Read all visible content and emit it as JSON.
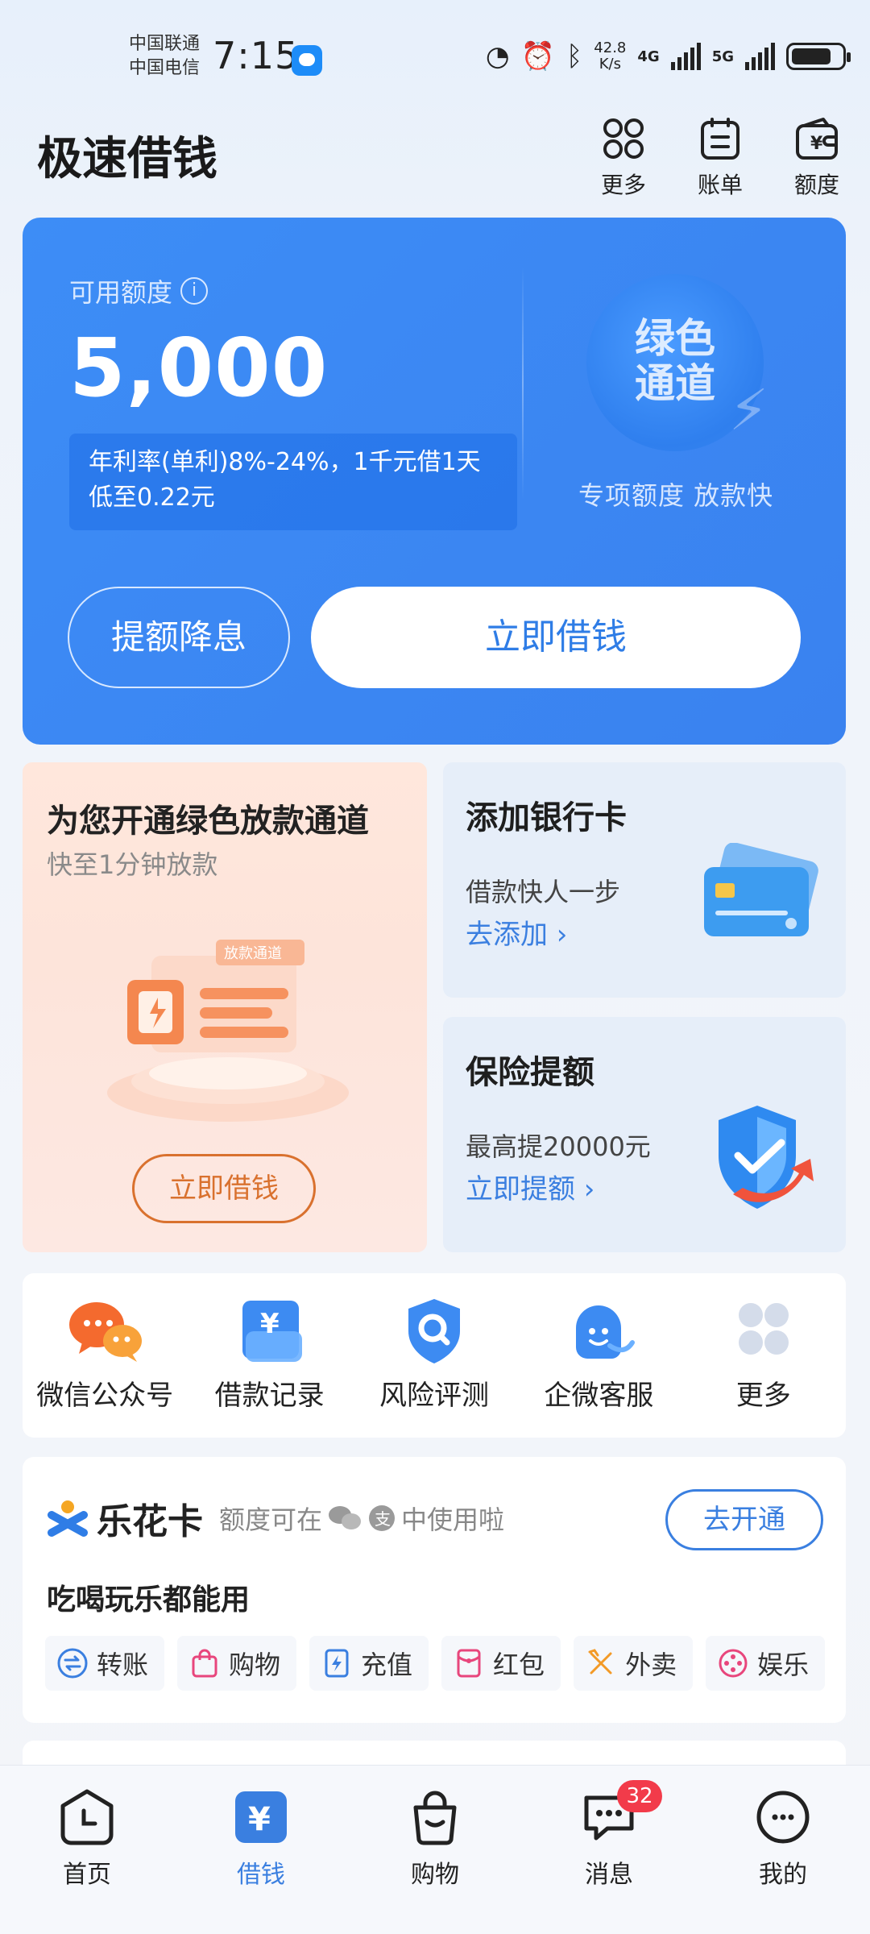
{
  "status_bar": {
    "carrier1": "中国联通",
    "carrier2": "中国电信",
    "time": "7:15",
    "net_speed_value": "42.8",
    "net_speed_unit": "K/s",
    "net1": "4G",
    "net2": "5G"
  },
  "header": {
    "title": "极速借钱",
    "actions": [
      {
        "label": "更多",
        "icon": "grid-icon"
      },
      {
        "label": "账单",
        "icon": "bill-icon"
      },
      {
        "label": "额度",
        "icon": "wallet-icon"
      }
    ]
  },
  "credit": {
    "label": "可用额度",
    "amount": "5,000",
    "rate_text": "年利率(单利)8%-24%，1千元借1天低至0.22元",
    "badge_text_line1": "绿色",
    "badge_text_line2": "通道",
    "badge_sub": "专项额度  放款快",
    "raise_label": "提额降息",
    "borrow_label": "立即借钱"
  },
  "promos": {
    "green_channel": {
      "title": "为您开通绿色放款通道",
      "subtitle": "快至1分钟放款",
      "illus_tag": "放款通道",
      "cta": "立即借钱"
    },
    "bank_card": {
      "title": "添加银行卡",
      "desc": "借款快人一步",
      "link": "去添加 ›"
    },
    "insurance": {
      "title": "保险提额",
      "desc": "最高提20000元",
      "link": "立即提额 ›"
    }
  },
  "quick_actions": [
    {
      "label": "微信公众号",
      "icon": "wechat-official-icon"
    },
    {
      "label": "借款记录",
      "icon": "loan-record-icon"
    },
    {
      "label": "风险评测",
      "icon": "risk-assessment-icon"
    },
    {
      "label": "企微客服",
      "icon": "customer-service-icon"
    },
    {
      "label": "更多",
      "icon": "more-grid-icon"
    }
  ],
  "lehua": {
    "name": "乐花卡",
    "tip_prefix": "额度可在",
    "tip_suffix": "中使用啦",
    "open_label": "去开通",
    "slogan": "吃喝玩乐都能用",
    "chips": [
      {
        "label": "转账",
        "icon": "transfer-icon"
      },
      {
        "label": "购物",
        "icon": "shopping-bag-icon"
      },
      {
        "label": "充值",
        "icon": "recharge-icon"
      },
      {
        "label": "红包",
        "icon": "red-packet-icon"
      },
      {
        "label": "外卖",
        "icon": "takeout-icon"
      },
      {
        "label": "娱乐",
        "icon": "entertainment-icon"
      }
    ]
  },
  "bottom_nav": [
    {
      "label": "首页",
      "icon": "clock-home-icon"
    },
    {
      "label": "借钱",
      "icon": "yuan-icon",
      "active": true
    },
    {
      "label": "购物",
      "icon": "shopping-bag-icon"
    },
    {
      "label": "消息",
      "icon": "chat-icon",
      "badge": "32"
    },
    {
      "label": "我的",
      "icon": "profile-icon"
    }
  ],
  "colors": {
    "accent": "#3a7fe0",
    "card_blue": "#3b86f2",
    "promo_orange": "#d9712e",
    "badge_red": "#f23b4a"
  }
}
